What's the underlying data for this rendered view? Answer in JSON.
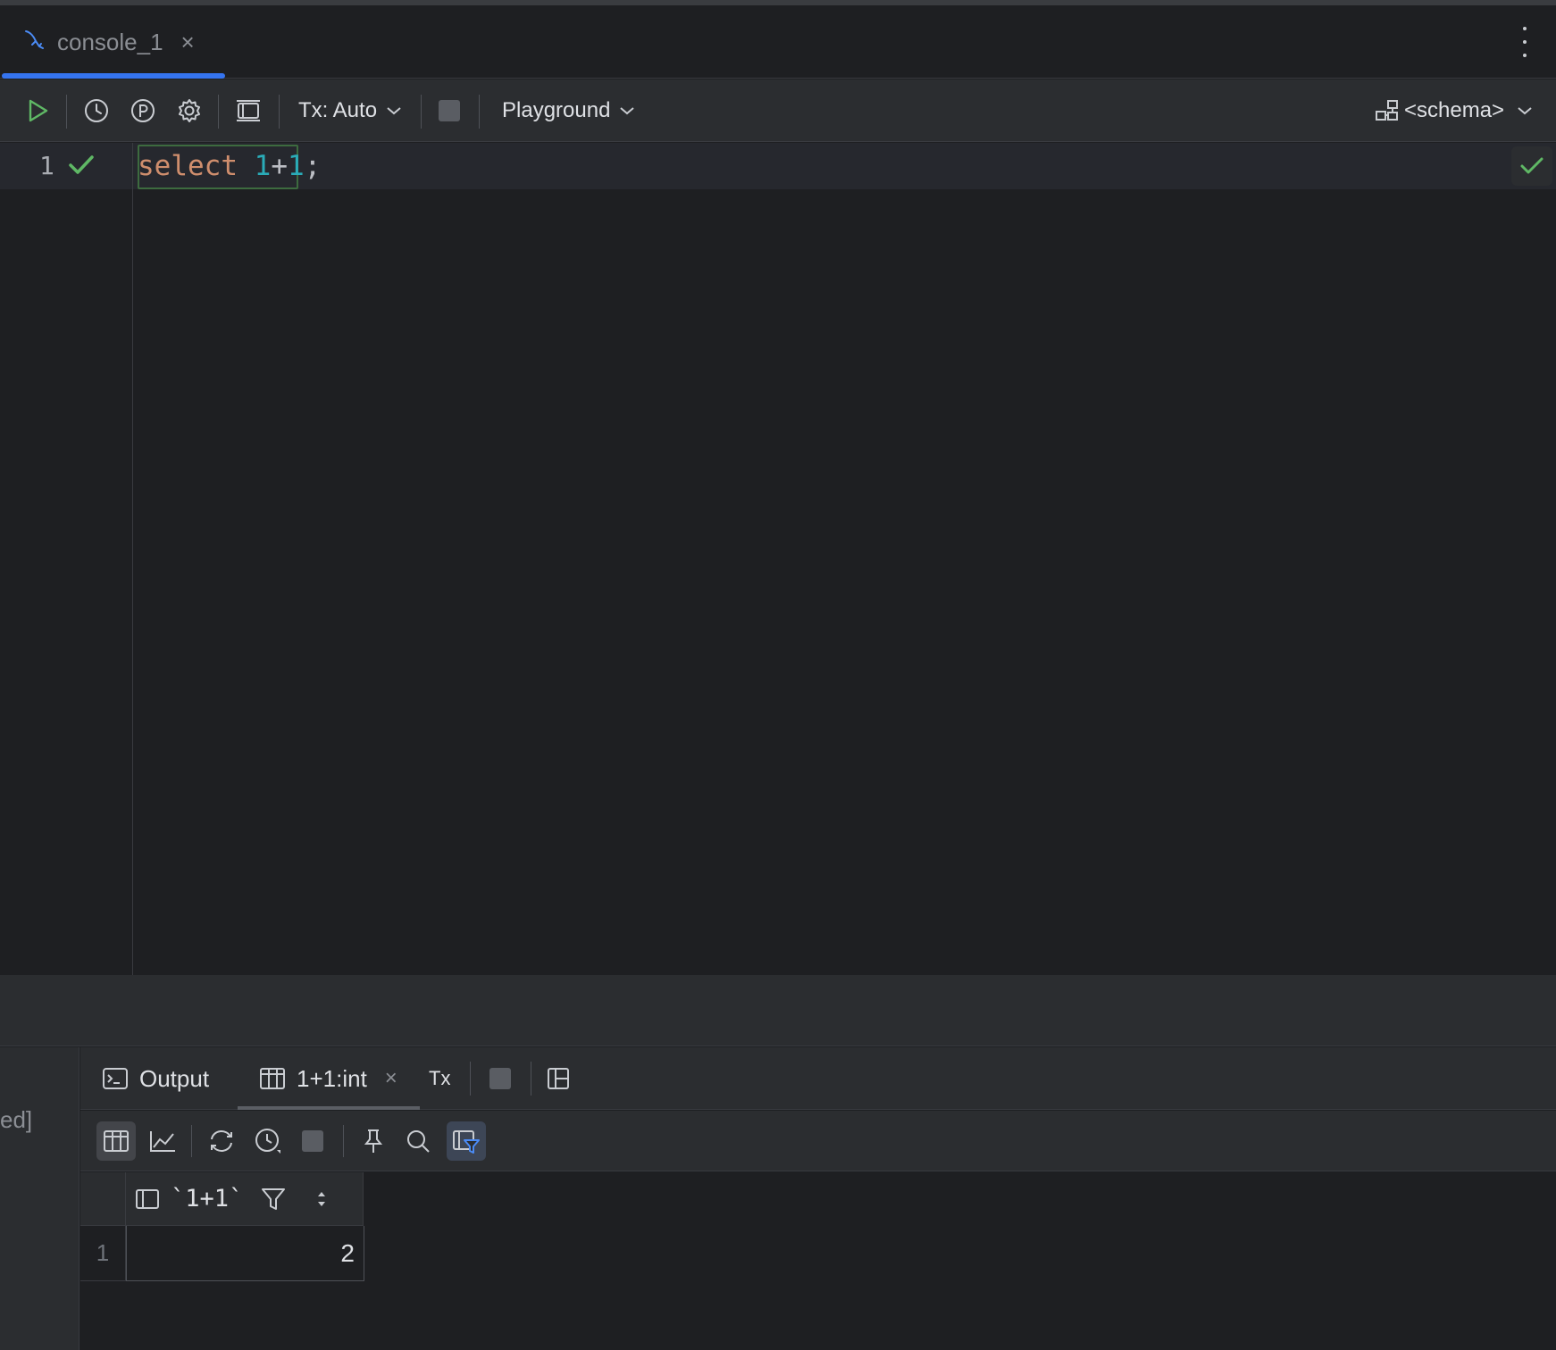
{
  "editor_tab": {
    "label": "console_1",
    "close": "×"
  },
  "toolbar": {
    "tx_label": "Tx: Auto",
    "playground_label": "Playground",
    "schema_label": "<schema>"
  },
  "editor": {
    "line_number": "1",
    "code": {
      "keyword": "select",
      "space": " ",
      "num1": "1",
      "plus": "+",
      "num2": "1",
      "semicolon": ";"
    }
  },
  "left_strip": {
    "cut_text": "ed]"
  },
  "results": {
    "tabs": [
      {
        "label": "Output"
      },
      {
        "label": "1+1:int",
        "close": "×"
      }
    ],
    "tx_label": "Tx",
    "columns": [
      "`1+1`"
    ],
    "rows": [
      {
        "row_number": "1",
        "values": [
          "2"
        ]
      }
    ]
  },
  "colors": {
    "background": "#1e1f22",
    "panel": "#2b2d30",
    "accent_blue": "#3574f0",
    "run_green": "#5fb865",
    "keyword": "#cf8e6d",
    "number": "#2aacb8"
  }
}
